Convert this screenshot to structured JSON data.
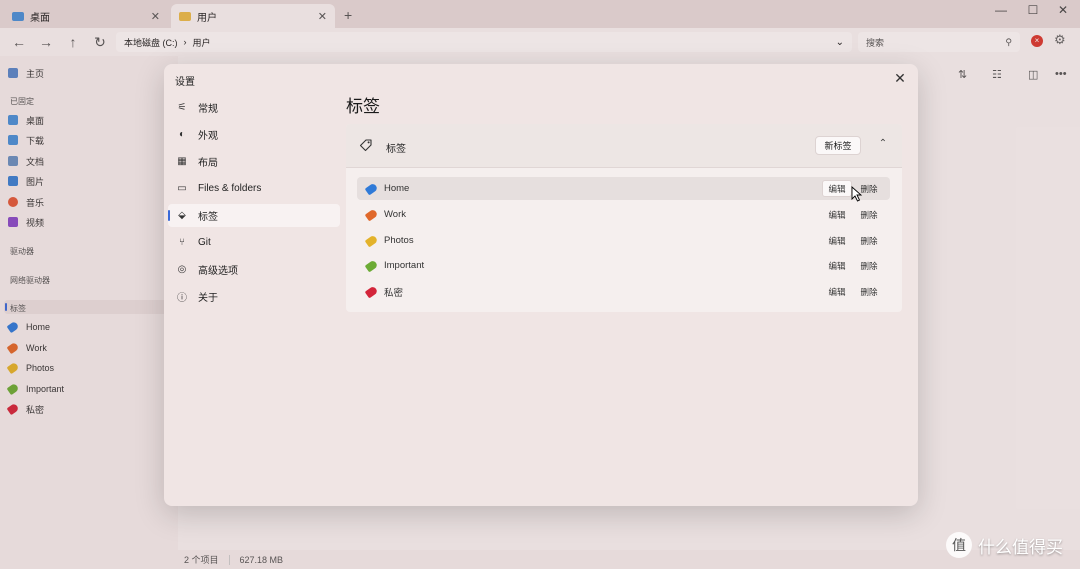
{
  "colors": {
    "accent": "#3a6ad9",
    "tag_home": "#2f7ad8",
    "tag_work": "#e0682a",
    "tag_photos": "#e3b22a",
    "tag_important": "#6cab35",
    "tag_private": "#d3253a"
  },
  "tabs": [
    {
      "label": "桌面",
      "close": "✕"
    },
    {
      "label": "用户",
      "close": "✕"
    }
  ],
  "new_tab": "+",
  "window_controls": {
    "minimize": "—",
    "maximize": "☐",
    "close": "✕"
  },
  "nav_buttons": {
    "back": "←",
    "forward": "→",
    "up": "↑",
    "refresh": "↻"
  },
  "address": {
    "crumb1": "本地磁盘 (C:)",
    "sep": "›",
    "crumb2": "用户",
    "chevron": "⌄"
  },
  "search": {
    "placeholder": "搜索",
    "icon": "⚲"
  },
  "badge": "×",
  "gear": "⚙",
  "sidebar": {
    "home": "主页",
    "pinned_header": "已固定",
    "pinned": [
      {
        "label": "桌面",
        "icon": "desktop-icon",
        "color": "#4a8fd6"
      },
      {
        "label": "下载",
        "icon": "download-icon",
        "color": "#4a8fd6"
      },
      {
        "label": "文档",
        "icon": "documents-icon",
        "color": "#6a8fbf"
      },
      {
        "label": "图片",
        "icon": "pictures-icon",
        "color": "#3c7fd1"
      },
      {
        "label": "音乐",
        "icon": "music-icon",
        "color": "#e05a3a"
      },
      {
        "label": "视频",
        "icon": "videos-icon",
        "color": "#8a4bc7"
      }
    ],
    "drives_header": "驱动器",
    "network_header": "网络驱动器",
    "tags_header": "标签",
    "tags": [
      {
        "label": "Home",
        "color": "#2f7ad8"
      },
      {
        "label": "Work",
        "color": "#e0682a"
      },
      {
        "label": "Photos",
        "color": "#e3b22a"
      },
      {
        "label": "Important",
        "color": "#6cab35"
      },
      {
        "label": "私密",
        "color": "#d3253a"
      }
    ]
  },
  "toolbar_icons": {
    "view": "▤",
    "sort": "⇅",
    "layout": "☷",
    "preview": "◫",
    "more": "•••"
  },
  "statusbar": {
    "items": "2 个项目",
    "size": "627.18 MB"
  },
  "dialog": {
    "title": "设置",
    "close": "✕",
    "nav": [
      {
        "label": "常规",
        "icon": "sliders-icon",
        "glyph": "⚟"
      },
      {
        "label": "外观",
        "icon": "palette-icon",
        "glyph": "◐"
      },
      {
        "label": "布局",
        "icon": "layout-icon",
        "glyph": "▦"
      },
      {
        "label": "Files & folders",
        "icon": "folder-icon",
        "glyph": "▭"
      },
      {
        "label": "标签",
        "icon": "tag-icon",
        "glyph": "⬙"
      },
      {
        "label": "Git",
        "icon": "git-icon",
        "glyph": "⑂"
      },
      {
        "label": "高级选项",
        "icon": "advanced-icon",
        "glyph": "◎"
      },
      {
        "label": "关于",
        "icon": "info-icon",
        "glyph": "ⓘ"
      }
    ],
    "page_title": "标签",
    "card": {
      "label": "标签",
      "new_tag": "新标签",
      "collapse": "⌃",
      "edit": "编辑",
      "delete": "删除",
      "rows": [
        {
          "name": "Home",
          "color": "#2f7ad8"
        },
        {
          "name": "Work",
          "color": "#e0682a"
        },
        {
          "name": "Photos",
          "color": "#e3b22a"
        },
        {
          "name": "Important",
          "color": "#6cab35"
        },
        {
          "name": "私密",
          "color": "#d3253a"
        }
      ]
    }
  },
  "watermark": {
    "text": "什么值得买",
    "icon": "值"
  }
}
